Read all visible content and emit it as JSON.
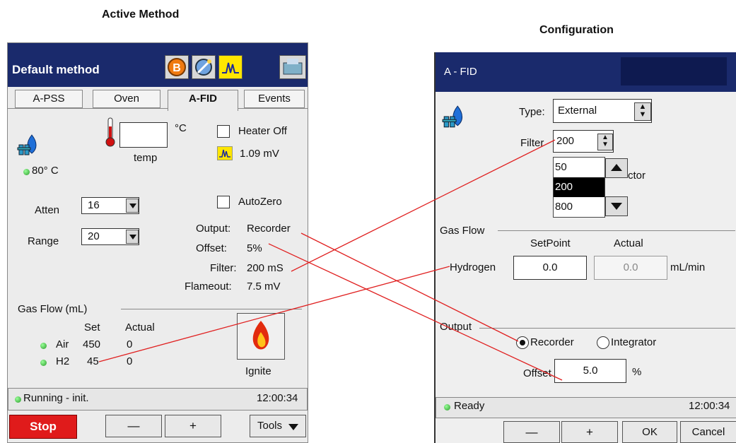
{
  "captions": {
    "left": "Active Method",
    "right": "Configuration"
  },
  "left": {
    "title": "Default method",
    "toolbar_icons": [
      "b-icon",
      "tools-icon",
      "chromatogram-icon",
      "printer-icon"
    ],
    "tabs": [
      "A-PSS",
      "Oven",
      "A-FID",
      "Events"
    ],
    "active_tab": "A-FID",
    "temp_unit": "°C",
    "temp_label": "temp",
    "temp_value": "",
    "detector_temp": "80° C",
    "heater_off_label": "Heater Off",
    "signal_value": "1.09 mV",
    "autozero_label": "AutoZero",
    "atten_label": "Atten",
    "atten_value": "16",
    "range_label": "Range",
    "range_value": "20",
    "output_label": "Output:",
    "output_value": "Recorder",
    "offset_label": "Offset:",
    "offset_value": "5%",
    "filter_label": "Filter:",
    "filter_value": "200 mS",
    "flameout_label": "Flameout:",
    "flameout_value": "7.5 mV",
    "gasflow_label": "Gas Flow  (mL)",
    "set_header": "Set",
    "actual_header": "Actual",
    "gases": [
      {
        "name": "Air",
        "set": "450",
        "actual": "0"
      },
      {
        "name": "H2",
        "set": "45",
        "actual": "0"
      }
    ],
    "ignite_label": "Ignite",
    "status_text": "Running - init.",
    "time": "12:00:34",
    "stop_label": "Stop",
    "minus_label": "—",
    "plus_label": "+",
    "tools_label": "Tools"
  },
  "right": {
    "title": "A - FID",
    "type_label": "Type:",
    "type_value": "External",
    "filter_label": "Filter",
    "filter_value": "200",
    "filter_options": [
      "50",
      "200",
      "800"
    ],
    "filter_selected": "200",
    "hidden_label_fragment": "ctor",
    "gasflow_label": "Gas Flow",
    "setpoint_header": "SetPoint",
    "actual_header": "Actual",
    "hydrogen_label": "Hydrogen",
    "hydrogen_set": "0.0",
    "hydrogen_actual": "0.0",
    "unit": "mL/min",
    "output_label": "Output",
    "radio_recorder": "Recorder",
    "radio_integrator": "Integrator",
    "offset_label": "Offset",
    "offset_value": "5.0",
    "offset_unit": "%",
    "status_text": "Ready",
    "time": "12:00:34",
    "minus_label": "—",
    "plus_label": "+",
    "ok_label": "OK",
    "cancel_label": "Cancel"
  },
  "colors": {
    "titlebar": "#1a2a6c",
    "stop": "#e01b1b",
    "connector_lines": "#e02020",
    "led": "#2a9a2a"
  }
}
